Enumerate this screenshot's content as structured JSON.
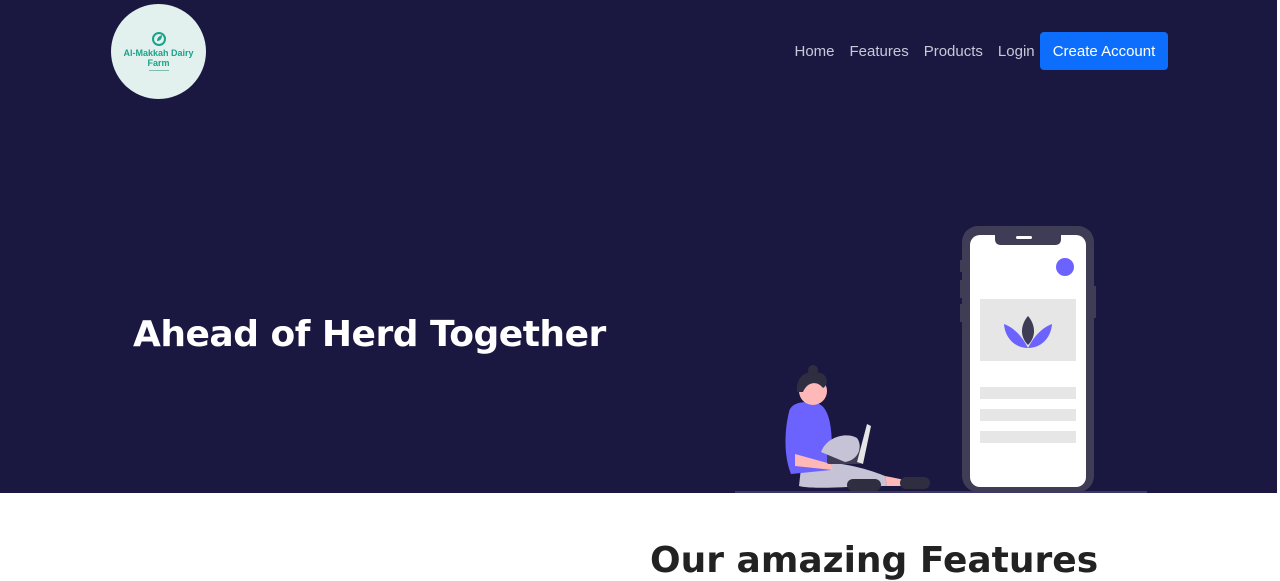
{
  "brand": {
    "line1": "Al-Makkah Dairy",
    "line2": "Farm",
    "accent": "#1aa38a"
  },
  "nav": {
    "items": [
      "Home",
      "Features",
      "Products",
      "Login"
    ],
    "cta": "Create Account"
  },
  "hero": {
    "headline": "Ahead of Herd Together",
    "background": "#1a1840"
  },
  "features": {
    "title": "Our amazing Features"
  },
  "colors": {
    "primary": "#0d6efd",
    "illustration_accent": "#6c63ff"
  }
}
